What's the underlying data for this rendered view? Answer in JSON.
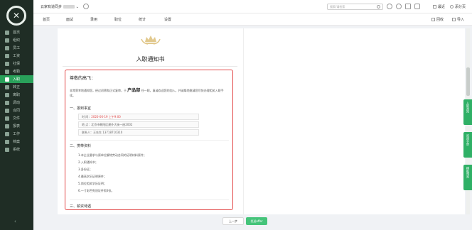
{
  "topbar": {
    "company": "云家有道同步",
    "search_placeholder": "搜索/请检索",
    "action_recent": "最近",
    "action_switch": "添分页"
  },
  "menubar": {
    "items": [
      "首页",
      "面试",
      "录用",
      "职位",
      "统计",
      "设置"
    ],
    "right_1": "回收",
    "right_2": "导入"
  },
  "sidebar": {
    "items": [
      "首页",
      "组织",
      "员工",
      "工资",
      "社保",
      "考勤",
      "入职",
      "转正",
      "离职",
      "调动",
      "合同",
      "文件",
      "报表",
      "工作",
      "档案",
      "系统"
    ],
    "active_index": 6
  },
  "document": {
    "title": "入职通知书",
    "greeting": "尊敬的高飞：",
    "paragraph_before": "非常荣幸地通知您，经过初筛和正式复审，于",
    "position_highlight": "产品部",
    "paragraph_after": "任一职。真诚欢迎您的加入。并诚挚地邀请您尽快办理相关入职手续。",
    "section1": "一、报到事宜",
    "time_label": "时 间：",
    "time_value": "2020-06-19 上午9:00",
    "place_label": "地 点：",
    "place_value": "北京市朝阳区建外大街一座2002",
    "contact_label": "联系人：",
    "contact_value": "王先生 13718710310",
    "section2": "二、携带资料",
    "materials": [
      "1.本企业要求与原单位解除劳动合同的证明材料原件；",
      "2.入职通知书；",
      "3.身份证；",
      "4.最高学历证明原件；",
      "5.岗位相关学历证明；",
      "6.一寸彩色免冠证件照3张。"
    ],
    "section3": "三、薪资待遇"
  },
  "right_tabs": [
    "入职须知",
    "欢迎手册",
    "模板预览"
  ],
  "footer": {
    "prev": "上一步",
    "next": "发送offer"
  },
  "colors": {
    "accent": "#2fb066",
    "highlight_border": "#e24848",
    "sidebar_bg": "#1f2d25"
  }
}
